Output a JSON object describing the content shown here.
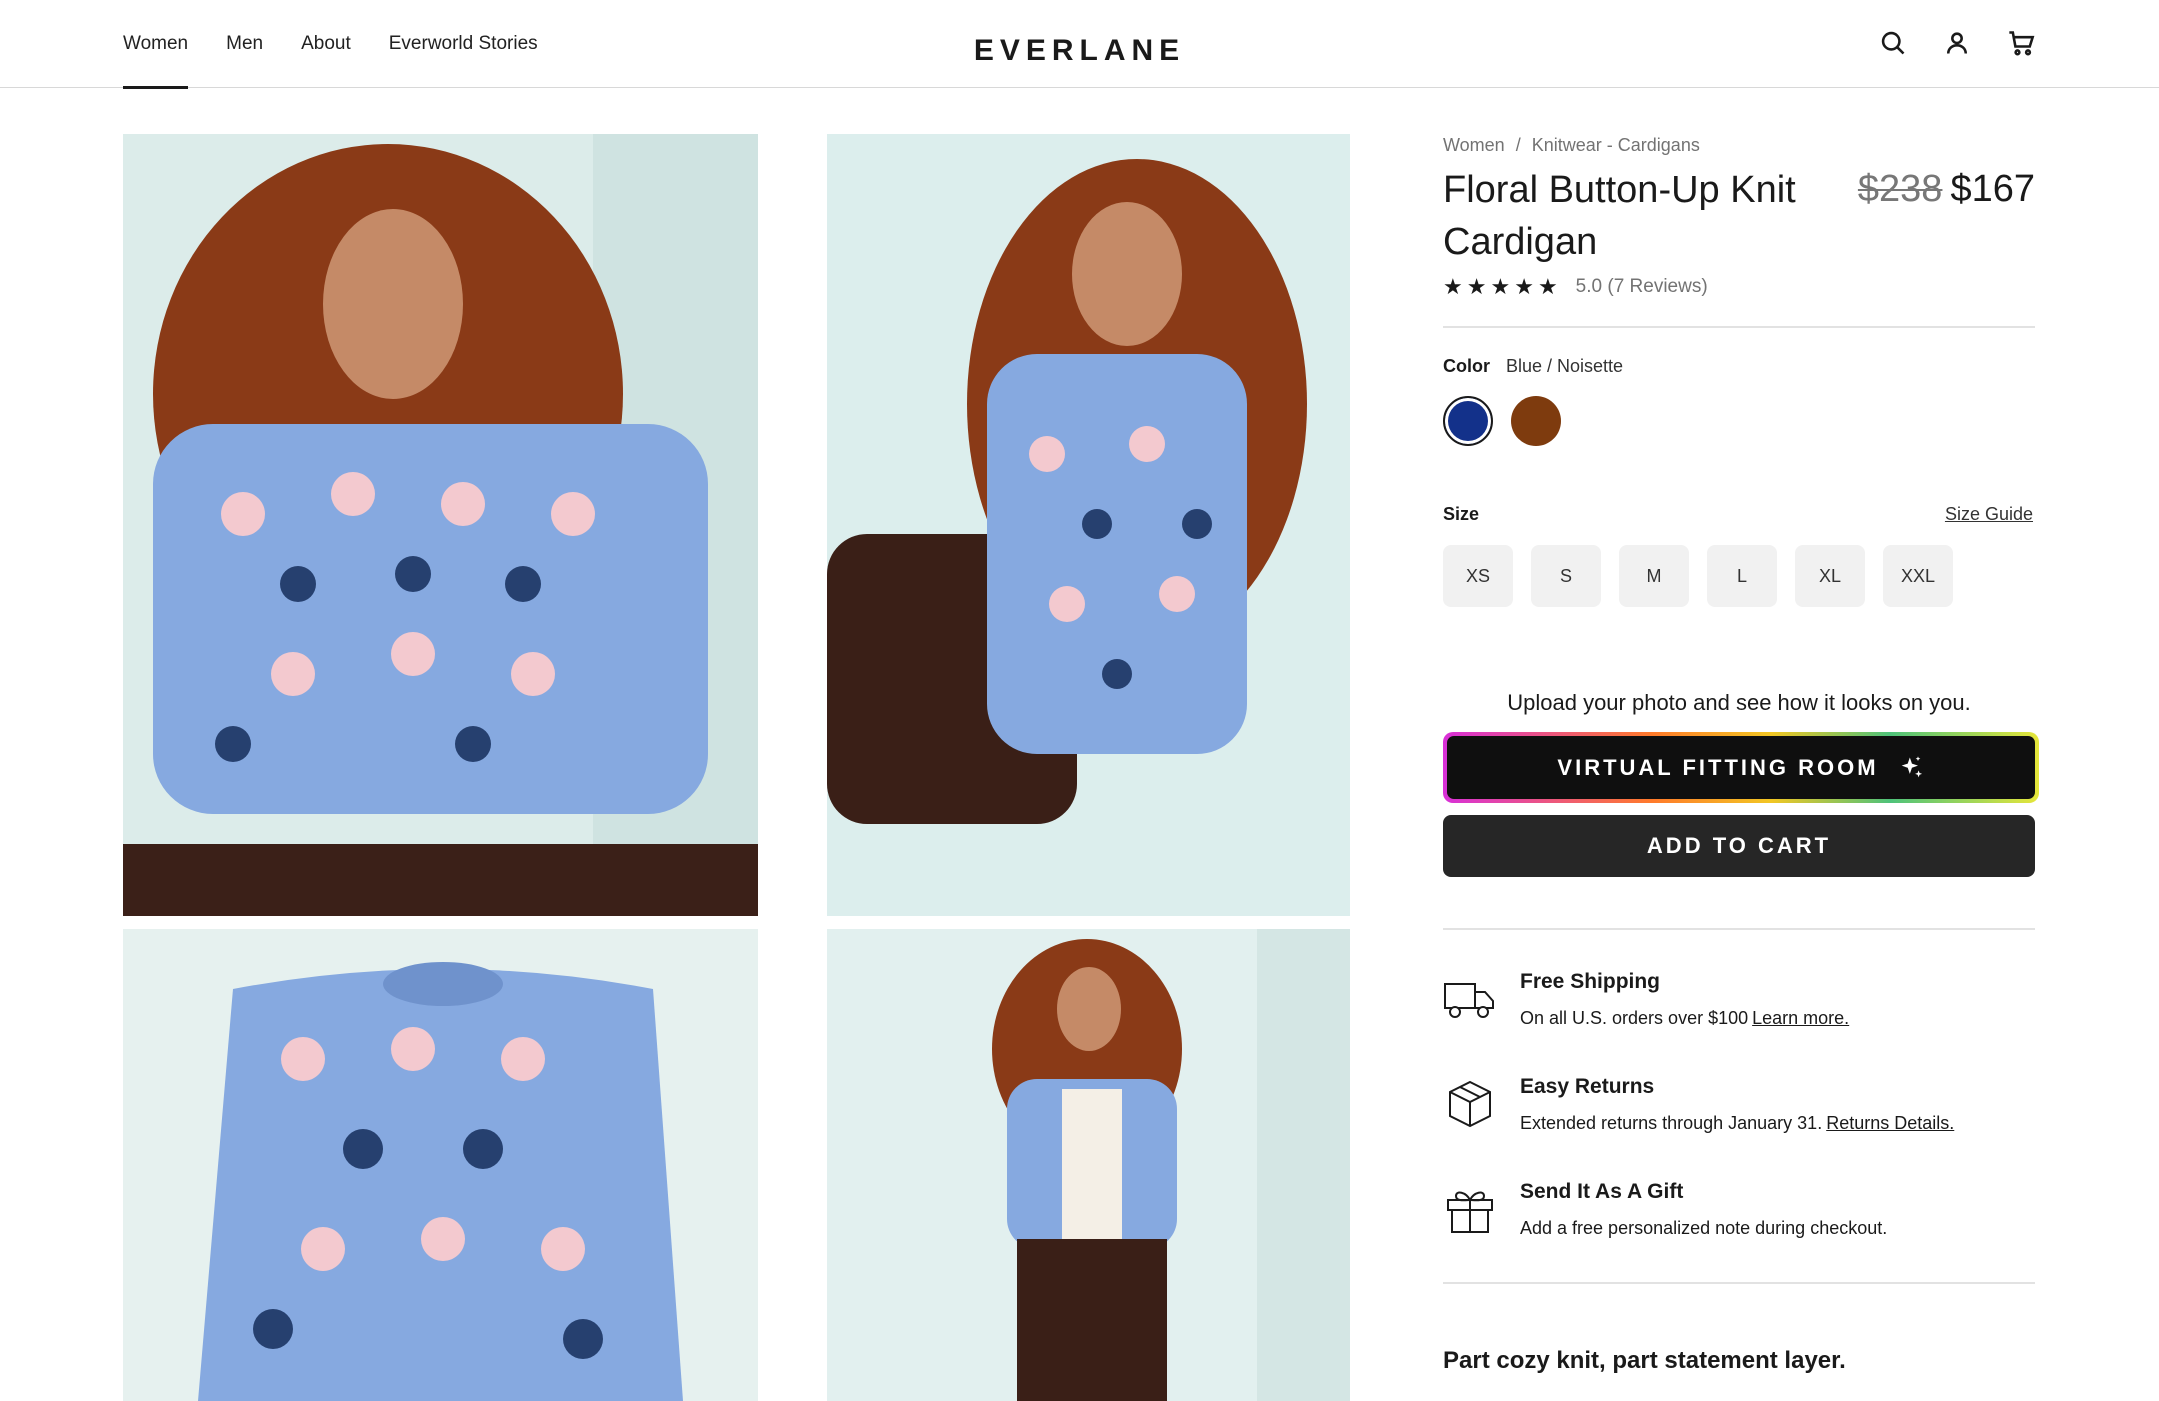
{
  "header": {
    "nav": [
      {
        "label": "Women",
        "active": true
      },
      {
        "label": "Men"
      },
      {
        "label": "About"
      },
      {
        "label": "Everworld Stories"
      }
    ],
    "logo": "EVERLANE",
    "icons": [
      "search-icon",
      "account-icon",
      "cart-icon"
    ]
  },
  "gallery": {
    "images": [
      "model-front-view",
      "model-seated-side-view",
      "cardigan-flat-product",
      "model-full-length-view"
    ]
  },
  "product": {
    "breadcrumb": {
      "parent": "Women",
      "separator": "/",
      "category": "Knitwear - Cardigans"
    },
    "title": "Floral Button-Up Knit Cardigan",
    "price_original": "$238",
    "price_sale": "$167",
    "rating_value": 5.0,
    "rating_text": "5.0 (7 Reviews)",
    "color_label": "Color",
    "color_value": "Blue / Noisette",
    "colors": [
      {
        "name": "Blue",
        "hex": "#13318a",
        "selected": true
      },
      {
        "name": "Noisette",
        "hex": "#7e3b0e",
        "selected": false
      }
    ],
    "size_label": "Size",
    "size_guide": "Size Guide",
    "sizes": [
      "XS",
      "S",
      "M",
      "L",
      "XL",
      "XXL"
    ],
    "upload_prompt": "Upload your photo and see how it looks on you.",
    "virtual_fitting_label": "VIRTUAL FITTING ROOM",
    "add_to_cart_label": "ADD TO CART"
  },
  "perks": [
    {
      "icon": "truck-icon",
      "title": "Free Shipping",
      "desc": "On all U.S. orders over $100",
      "link": "Learn more."
    },
    {
      "icon": "box-icon",
      "title": "Easy Returns",
      "desc": "Extended returns through January 31.",
      "link": "Returns Details."
    },
    {
      "icon": "gift-icon",
      "title": "Send It As A Gift",
      "desc": "Add a free personalized note during checkout.",
      "link": ""
    }
  ],
  "tagline": "Part cozy knit, part statement layer.",
  "colors": {
    "accent_dark": "#0f0f0f",
    "button": "#262626",
    "muted_text": "#737373",
    "image_bg": "#dcecea"
  }
}
